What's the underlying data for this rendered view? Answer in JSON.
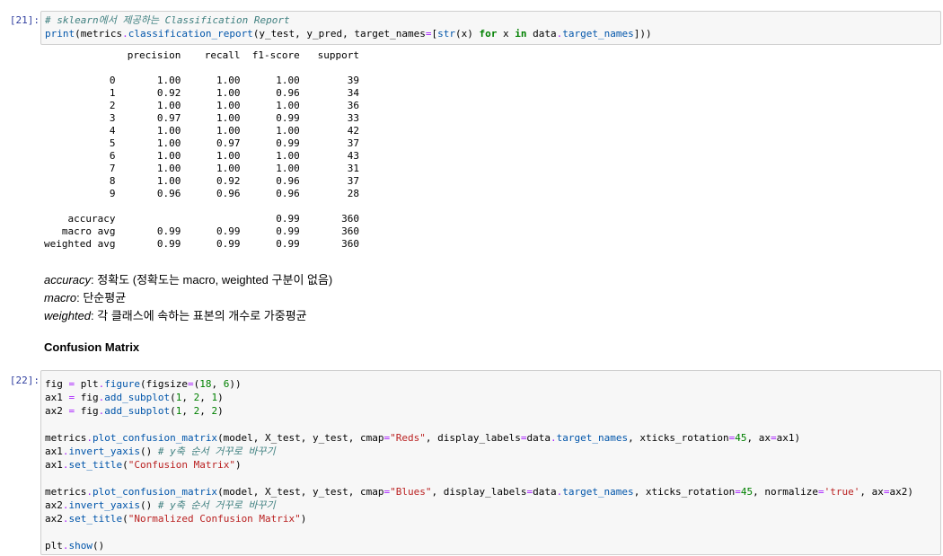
{
  "cell21": {
    "prompt": "[21]:",
    "code_lines": [
      [
        {
          "t": "cm",
          "v": "# sklearn에서 제공하는 Classification Report"
        }
      ],
      [
        {
          "t": "fn",
          "v": "print"
        },
        {
          "t": "",
          "v": "(metrics"
        },
        {
          "t": "op",
          "v": "."
        },
        {
          "t": "fn",
          "v": "classification_report"
        },
        {
          "t": "",
          "v": "(y_test, y_pred, target_names"
        },
        {
          "t": "op",
          "v": "="
        },
        {
          "t": "",
          "v": "["
        },
        {
          "t": "fn",
          "v": "str"
        },
        {
          "t": "",
          "v": "(x) "
        },
        {
          "t": "kw",
          "v": "for"
        },
        {
          "t": "",
          "v": " x "
        },
        {
          "t": "kw",
          "v": "in"
        },
        {
          "t": "",
          "v": " data"
        },
        {
          "t": "op",
          "v": "."
        },
        {
          "t": "attr",
          "v": "target_names"
        },
        {
          "t": "",
          "v": "]))"
        }
      ]
    ],
    "output_text": "              precision    recall  f1-score   support\n\n           0       1.00      1.00      1.00        39\n           1       0.92      1.00      0.96        34\n           2       1.00      1.00      1.00        36\n           3       0.97      1.00      0.99        33\n           4       1.00      1.00      1.00        42\n           5       1.00      0.97      0.99        37\n           6       1.00      1.00      1.00        43\n           7       1.00      1.00      1.00        31\n           8       1.00      0.92      0.96        37\n           9       0.96      0.96      0.96        28\n\n    accuracy                           0.99       360\n   macro avg       0.99      0.99      0.99       360\nweighted avg       0.99      0.99      0.99       360"
  },
  "markdown": {
    "lines": [
      {
        "term": "accuracy",
        "text": ": 정확도 (정확도는 macro, weighted 구분이 없음)"
      },
      {
        "term": "macro",
        "text": ": 단순평균"
      },
      {
        "term": "weighted",
        "text": ": 각 클래스에 속하는 표본의 개수로 가중평균"
      }
    ],
    "heading": "Confusion Matrix"
  },
  "cell22": {
    "prompt": "[22]:",
    "code_lines": [
      [
        {
          "t": "",
          "v": "fig "
        },
        {
          "t": "op",
          "v": "="
        },
        {
          "t": "",
          "v": " plt"
        },
        {
          "t": "op",
          "v": "."
        },
        {
          "t": "fn",
          "v": "figure"
        },
        {
          "t": "",
          "v": "(figsize"
        },
        {
          "t": "op",
          "v": "="
        },
        {
          "t": "",
          "v": "("
        },
        {
          "t": "num",
          "v": "18"
        },
        {
          "t": "",
          "v": ", "
        },
        {
          "t": "num",
          "v": "6"
        },
        {
          "t": "",
          "v": "))"
        }
      ],
      [
        {
          "t": "",
          "v": "ax1 "
        },
        {
          "t": "op",
          "v": "="
        },
        {
          "t": "",
          "v": " fig"
        },
        {
          "t": "op",
          "v": "."
        },
        {
          "t": "fn",
          "v": "add_subplot"
        },
        {
          "t": "",
          "v": "("
        },
        {
          "t": "num",
          "v": "1"
        },
        {
          "t": "",
          "v": ", "
        },
        {
          "t": "num",
          "v": "2"
        },
        {
          "t": "",
          "v": ", "
        },
        {
          "t": "num",
          "v": "1"
        },
        {
          "t": "",
          "v": ")"
        }
      ],
      [
        {
          "t": "",
          "v": "ax2 "
        },
        {
          "t": "op",
          "v": "="
        },
        {
          "t": "",
          "v": " fig"
        },
        {
          "t": "op",
          "v": "."
        },
        {
          "t": "fn",
          "v": "add_subplot"
        },
        {
          "t": "",
          "v": "("
        },
        {
          "t": "num",
          "v": "1"
        },
        {
          "t": "",
          "v": ", "
        },
        {
          "t": "num",
          "v": "2"
        },
        {
          "t": "",
          "v": ", "
        },
        {
          "t": "num",
          "v": "2"
        },
        {
          "t": "",
          "v": ")"
        }
      ],
      [],
      [
        {
          "t": "",
          "v": "metrics"
        },
        {
          "t": "op",
          "v": "."
        },
        {
          "t": "fn",
          "v": "plot_confusion_matrix"
        },
        {
          "t": "",
          "v": "(model, X_test, y_test, cmap"
        },
        {
          "t": "op",
          "v": "="
        },
        {
          "t": "str",
          "v": "\"Reds\""
        },
        {
          "t": "",
          "v": ", display_labels"
        },
        {
          "t": "op",
          "v": "="
        },
        {
          "t": "",
          "v": "data"
        },
        {
          "t": "op",
          "v": "."
        },
        {
          "t": "attr",
          "v": "target_names"
        },
        {
          "t": "",
          "v": ", xticks_rotation"
        },
        {
          "t": "op",
          "v": "="
        },
        {
          "t": "num",
          "v": "45"
        },
        {
          "t": "",
          "v": ", ax"
        },
        {
          "t": "op",
          "v": "="
        },
        {
          "t": "",
          "v": "ax1)"
        }
      ],
      [
        {
          "t": "",
          "v": "ax1"
        },
        {
          "t": "op",
          "v": "."
        },
        {
          "t": "fn",
          "v": "invert_yaxis"
        },
        {
          "t": "",
          "v": "() "
        },
        {
          "t": "cm",
          "v": "# y축 순서 거꾸로 바꾸기"
        }
      ],
      [
        {
          "t": "",
          "v": "ax1"
        },
        {
          "t": "op",
          "v": "."
        },
        {
          "t": "fn",
          "v": "set_title"
        },
        {
          "t": "",
          "v": "("
        },
        {
          "t": "str",
          "v": "\"Confusion Matrix\""
        },
        {
          "t": "",
          "v": ")"
        }
      ],
      [],
      [
        {
          "t": "",
          "v": "metrics"
        },
        {
          "t": "op",
          "v": "."
        },
        {
          "t": "fn",
          "v": "plot_confusion_matrix"
        },
        {
          "t": "",
          "v": "(model, X_test, y_test, cmap"
        },
        {
          "t": "op",
          "v": "="
        },
        {
          "t": "str",
          "v": "\"Blues\""
        },
        {
          "t": "",
          "v": ", display_labels"
        },
        {
          "t": "op",
          "v": "="
        },
        {
          "t": "",
          "v": "data"
        },
        {
          "t": "op",
          "v": "."
        },
        {
          "t": "attr",
          "v": "target_names"
        },
        {
          "t": "",
          "v": ", xticks_rotation"
        },
        {
          "t": "op",
          "v": "="
        },
        {
          "t": "num",
          "v": "45"
        },
        {
          "t": "",
          "v": ", normalize"
        },
        {
          "t": "op",
          "v": "="
        },
        {
          "t": "str",
          "v": "'true'"
        },
        {
          "t": "",
          "v": ", ax"
        },
        {
          "t": "op",
          "v": "="
        },
        {
          "t": "",
          "v": "ax2)"
        }
      ],
      [
        {
          "t": "",
          "v": "ax2"
        },
        {
          "t": "op",
          "v": "."
        },
        {
          "t": "fn",
          "v": "invert_yaxis"
        },
        {
          "t": "",
          "v": "() "
        },
        {
          "t": "cm",
          "v": "# y축 순서 거꾸로 바꾸기"
        }
      ],
      [
        {
          "t": "",
          "v": "ax2"
        },
        {
          "t": "op",
          "v": "."
        },
        {
          "t": "fn",
          "v": "set_title"
        },
        {
          "t": "",
          "v": "("
        },
        {
          "t": "str",
          "v": "\"Normalized Confusion Matrix\""
        },
        {
          "t": "",
          "v": ")"
        }
      ],
      [],
      [
        {
          "t": "",
          "v": "plt"
        },
        {
          "t": "op",
          "v": "."
        },
        {
          "t": "fn",
          "v": "show"
        },
        {
          "t": "",
          "v": "()"
        }
      ]
    ]
  }
}
